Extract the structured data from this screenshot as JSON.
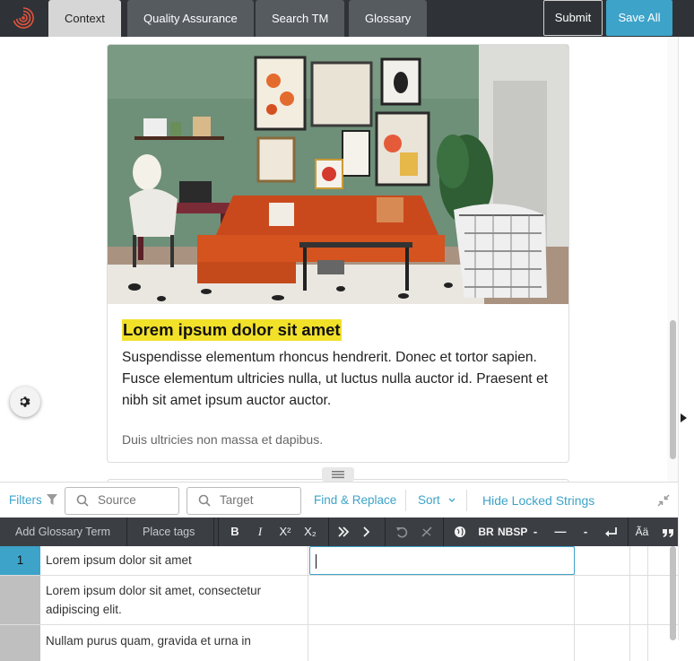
{
  "tabs": [
    {
      "label": "Context",
      "active": true
    },
    {
      "label": "Quality Assurance",
      "active": false
    },
    {
      "label": "Search TM",
      "active": false
    },
    {
      "label": "Glossary",
      "active": false
    }
  ],
  "actions": {
    "submit": "Submit",
    "save_all": "Save All"
  },
  "card": {
    "title": "Lorem ipsum dolor sit amet",
    "body": "Suspendisse elementum rhoncus hendrerit. Donec et tortor sapien. Fusce elementum ultricies nulla, ut luctus nulla auctor id. Praesent et nibh sit amet ipsum auctor auctor.",
    "footer": "Duis ultricies non massa et dapibus."
  },
  "filters": {
    "label": "Filters",
    "source_placeholder": "Source",
    "target_placeholder": "Target",
    "find_replace": "Find & Replace",
    "sort": "Sort",
    "hide_locked": "Hide Locked Strings"
  },
  "toolbar": {
    "add_glossary_term": "Add Glossary Term",
    "place_tags": "Place tags",
    "bold": "B",
    "italic": "I",
    "superscript": "X²",
    "subscript": "X₂",
    "br": "BR",
    "nbsp": "NBSP",
    "hyphen": "-",
    "em_dash": "—",
    "en_dash": "-",
    "letter_case": "Ãä"
  },
  "rows": [
    {
      "num": "1",
      "source": "Lorem ipsum dolor sit amet",
      "target": ""
    },
    {
      "num": "",
      "source": "Lorem ipsum dolor sit amet, consectetur adipiscing elit.",
      "target": ""
    },
    {
      "num": "",
      "source": "Nullam purus quam, gravida et urna in",
      "target": ""
    }
  ],
  "colors": {
    "accent": "#3da3c9",
    "topbar": "#2f3337",
    "highlight": "#f2e129",
    "toolbar": "#3b3f44"
  }
}
